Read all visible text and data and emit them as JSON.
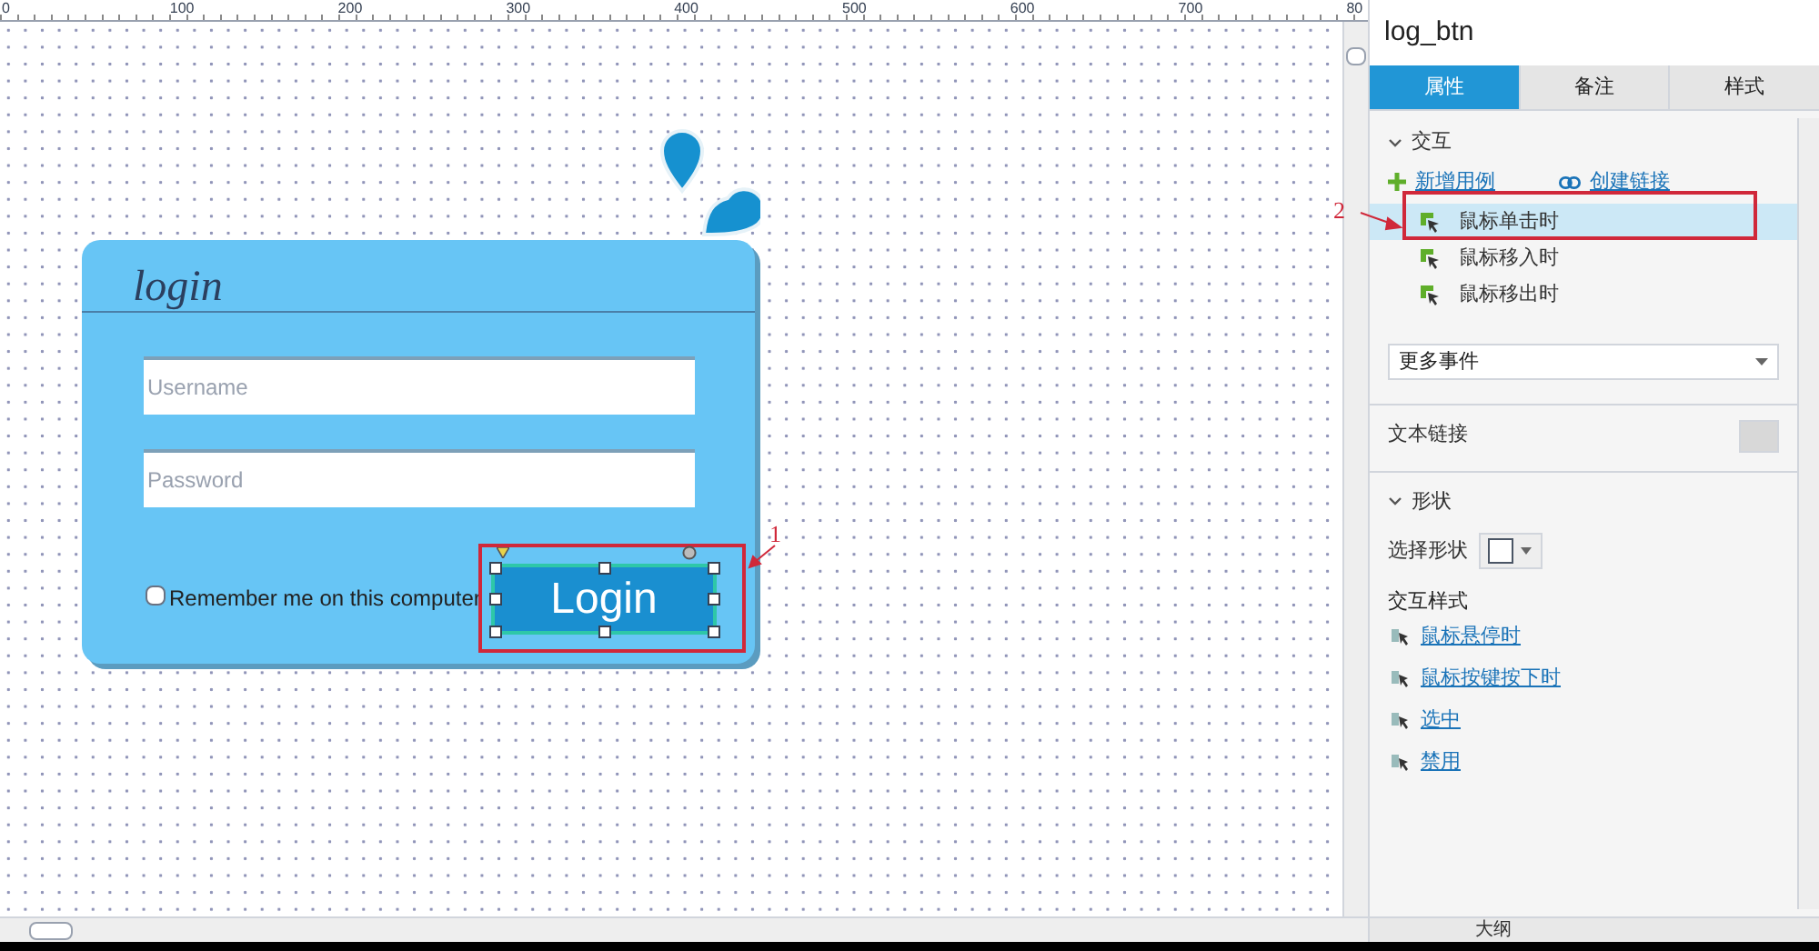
{
  "ruler": {
    "labels": [
      "0",
      "100",
      "200",
      "300",
      "400",
      "500",
      "600",
      "700",
      "80"
    ]
  },
  "canvas": {
    "login_card": {
      "title": "login",
      "username": {
        "placeholder": "Username"
      },
      "password": {
        "placeholder": "Password"
      },
      "remember": {
        "label": "Remember me on this computer",
        "checked": false
      },
      "login_button": {
        "label": "Login",
        "selected": true
      }
    },
    "annotation": "1"
  },
  "panel": {
    "title": "log_btn",
    "tabs": [
      {
        "label": "属性",
        "selected": true
      },
      {
        "label": "备注",
        "selected": false
      },
      {
        "label": "样式",
        "selected": false
      }
    ],
    "interaction": {
      "heading": "交互",
      "expanded": true,
      "add_case": "新增用例",
      "create_link": "创建链接",
      "annotation": "2",
      "events": [
        {
          "label": "鼠标单击时",
          "selected": true
        },
        {
          "label": "鼠标移入时",
          "selected": false
        },
        {
          "label": "鼠标移出时",
          "selected": false
        }
      ],
      "more_events": "更多事件"
    },
    "text_link": {
      "label": "文本链接"
    },
    "shape": {
      "heading": "形状",
      "expanded": true,
      "select_shape_label": "选择形状"
    },
    "interaction_styles": {
      "heading": "交互样式",
      "items": [
        {
          "label": "鼠标悬停时"
        },
        {
          "label": "鼠标按键按下时"
        },
        {
          "label": "选中"
        },
        {
          "label": "禁用"
        }
      ]
    },
    "bottom_tab": "大纲"
  }
}
